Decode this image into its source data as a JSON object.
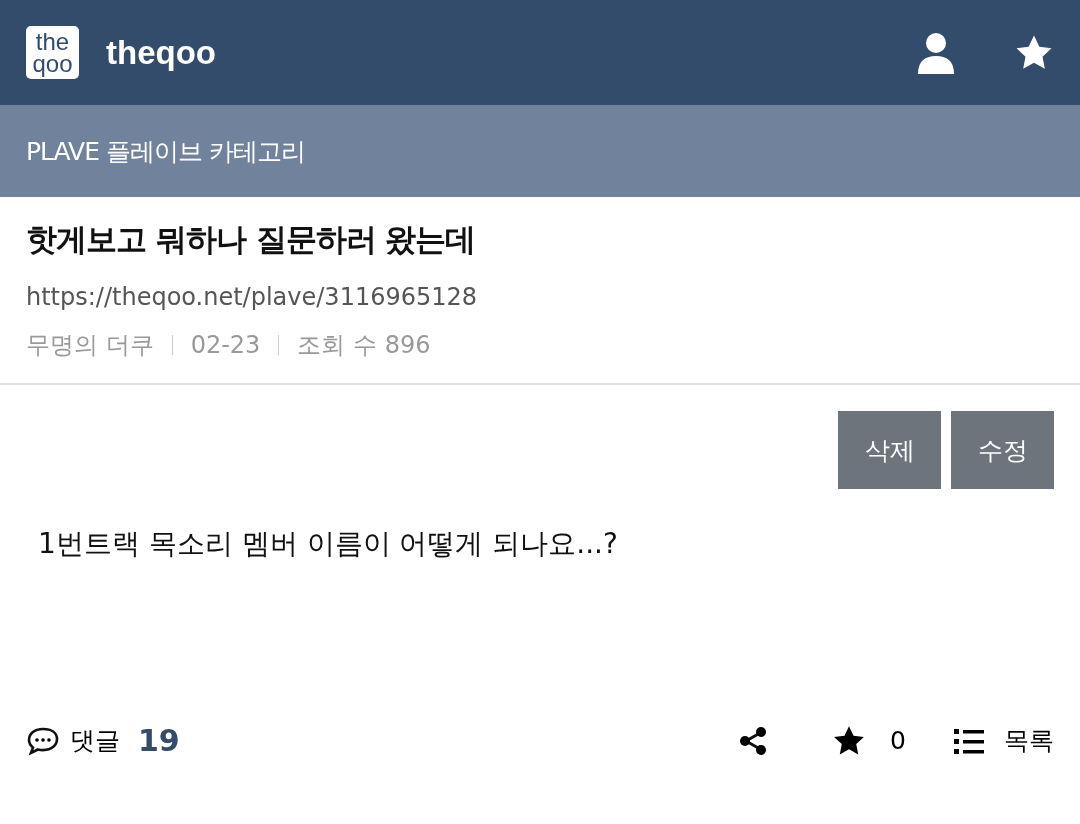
{
  "header": {
    "logo_lines": [
      "the",
      "qoo"
    ],
    "site_name": "theqoo"
  },
  "category": {
    "title": "PLAVE 플레이브 카테고리"
  },
  "post": {
    "title": "핫게보고 뭐하나 질문하러 왔는데",
    "url": "https://theqoo.net/plave/3116965128",
    "meta": [
      "무명의 더쿠",
      "02-23",
      "조회 수 896"
    ],
    "actions": [
      "삭제",
      "수정"
    ],
    "body": "1번트랙 목소리 멤버 이름이 어떻게 되나요...?"
  },
  "footer": {
    "comments_label": "댓글",
    "comments_count": "19",
    "star_count": "0",
    "list_label": "목록"
  }
}
